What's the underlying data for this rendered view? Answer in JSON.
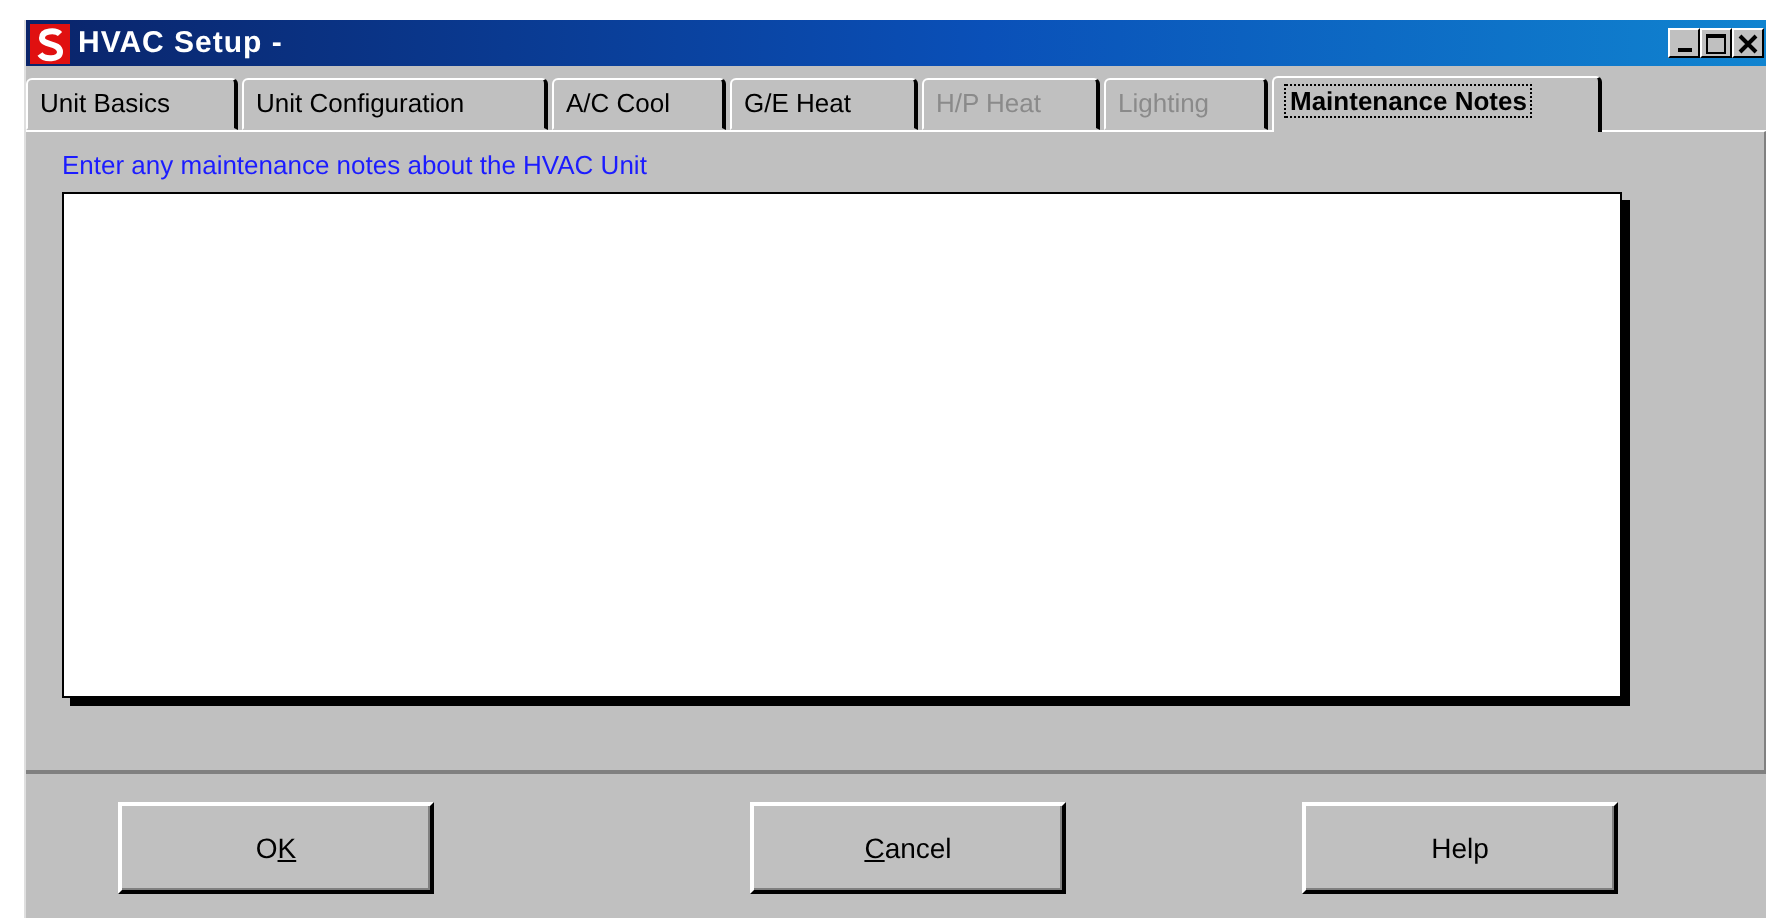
{
  "window": {
    "title": "HVAC Setup -"
  },
  "tabs": [
    {
      "label": "Unit Basics",
      "selected": false,
      "disabled": false
    },
    {
      "label": "Unit Configuration",
      "selected": false,
      "disabled": false
    },
    {
      "label": "A/C Cool",
      "selected": false,
      "disabled": false
    },
    {
      "label": "G/E Heat",
      "selected": false,
      "disabled": false
    },
    {
      "label": "H/P Heat",
      "selected": false,
      "disabled": true
    },
    {
      "label": "Lighting",
      "selected": false,
      "disabled": true
    },
    {
      "label": "Maintenance Notes",
      "selected": true,
      "disabled": false
    }
  ],
  "notes": {
    "label": "Enter any maintenance notes about the HVAC Unit"
  },
  "buttons": [
    {
      "pre": "O",
      "key": "K"
    },
    {
      "key": "C",
      "post": "ancel"
    },
    {
      "pre": "Help"
    }
  ]
}
